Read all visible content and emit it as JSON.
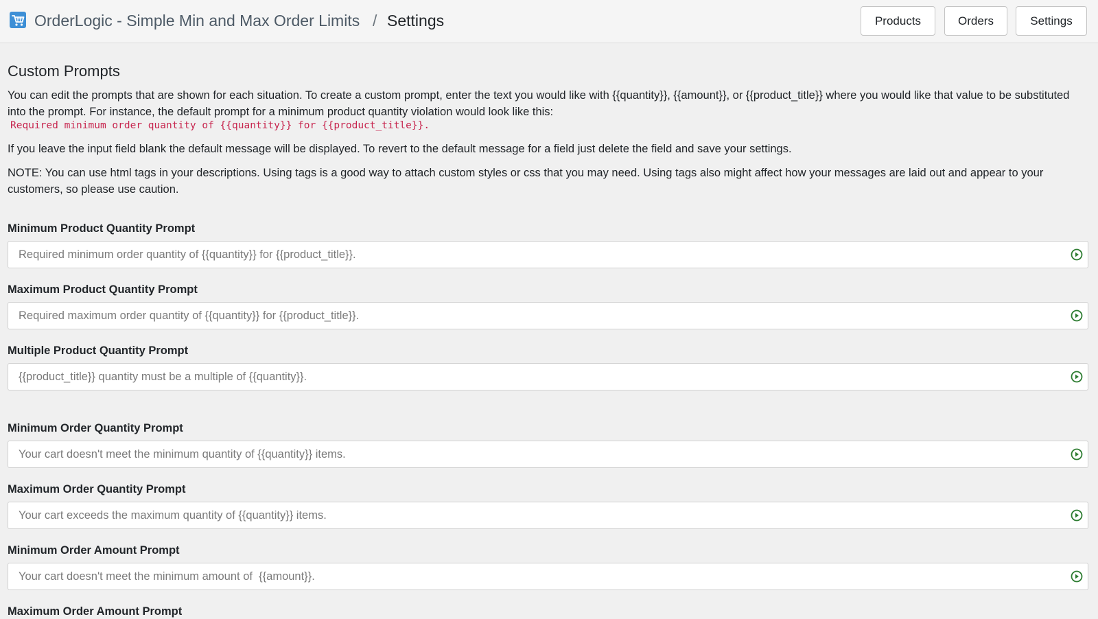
{
  "header": {
    "app_name": "OrderLogic - Simple Min and Max Order Limits",
    "separator": "/",
    "current_page": "Settings",
    "nav": {
      "products": "Products",
      "orders": "Orders",
      "settings": "Settings"
    }
  },
  "custom_prompts": {
    "title": "Custom Prompts",
    "intro": "You can edit the prompts that are shown for each situation. To create a custom prompt, enter the text you would like with {{quantity}}, {{amount}}, or {{product_title}} where you would like that value to be substituted into the prompt. For instance, the default prompt for a minimum product quantity violation would look like this:",
    "example_code": "Required minimum order quantity of {{quantity}} for {{product_title}}.",
    "blank_note": "If you leave the input field blank the default message will be displayed. To revert to the default message for a field just delete the field and save your settings.",
    "html_note": "NOTE: You can use html tags in your descriptions. Using tags is a good way to attach custom styles or css that you may need. Using tags also might affect how your messages are laid out and appear to your customers, so please use caution."
  },
  "fields": {
    "min_product_qty": {
      "label": "Minimum Product Quantity Prompt",
      "value": "",
      "placeholder": "Required minimum order quantity of {{quantity}} for {{product_title}}."
    },
    "max_product_qty": {
      "label": "Maximum Product Quantity Prompt",
      "value": "",
      "placeholder": "Required maximum order quantity of {{quantity}} for {{product_title}}."
    },
    "multiple_product_qty": {
      "label": "Multiple Product Quantity Prompt",
      "value": "",
      "placeholder": "{{product_title}} quantity must be a multiple of {{quantity}}."
    },
    "min_order_qty": {
      "label": "Minimum Order Quantity Prompt",
      "value": "",
      "placeholder": "Your cart doesn't meet the minimum quantity of {{quantity}} items."
    },
    "max_order_qty": {
      "label": "Maximum Order Quantity Prompt",
      "value": "",
      "placeholder": "Your cart exceeds the maximum quantity of {{quantity}} items."
    },
    "min_order_amount": {
      "label": "Minimum Order Amount Prompt",
      "value": "",
      "placeholder": "Your cart doesn't meet the minimum amount of  {{amount}}."
    },
    "max_order_amount": {
      "label": "Maximum Order Amount Prompt"
    }
  },
  "icons": {
    "app_logo": "shopping-cart-icon",
    "field_action": "play-circle-icon"
  },
  "colors": {
    "field_icon": "#2e7d32",
    "code_sample": "#c7254e",
    "app_logo": "#3d8fd6"
  }
}
